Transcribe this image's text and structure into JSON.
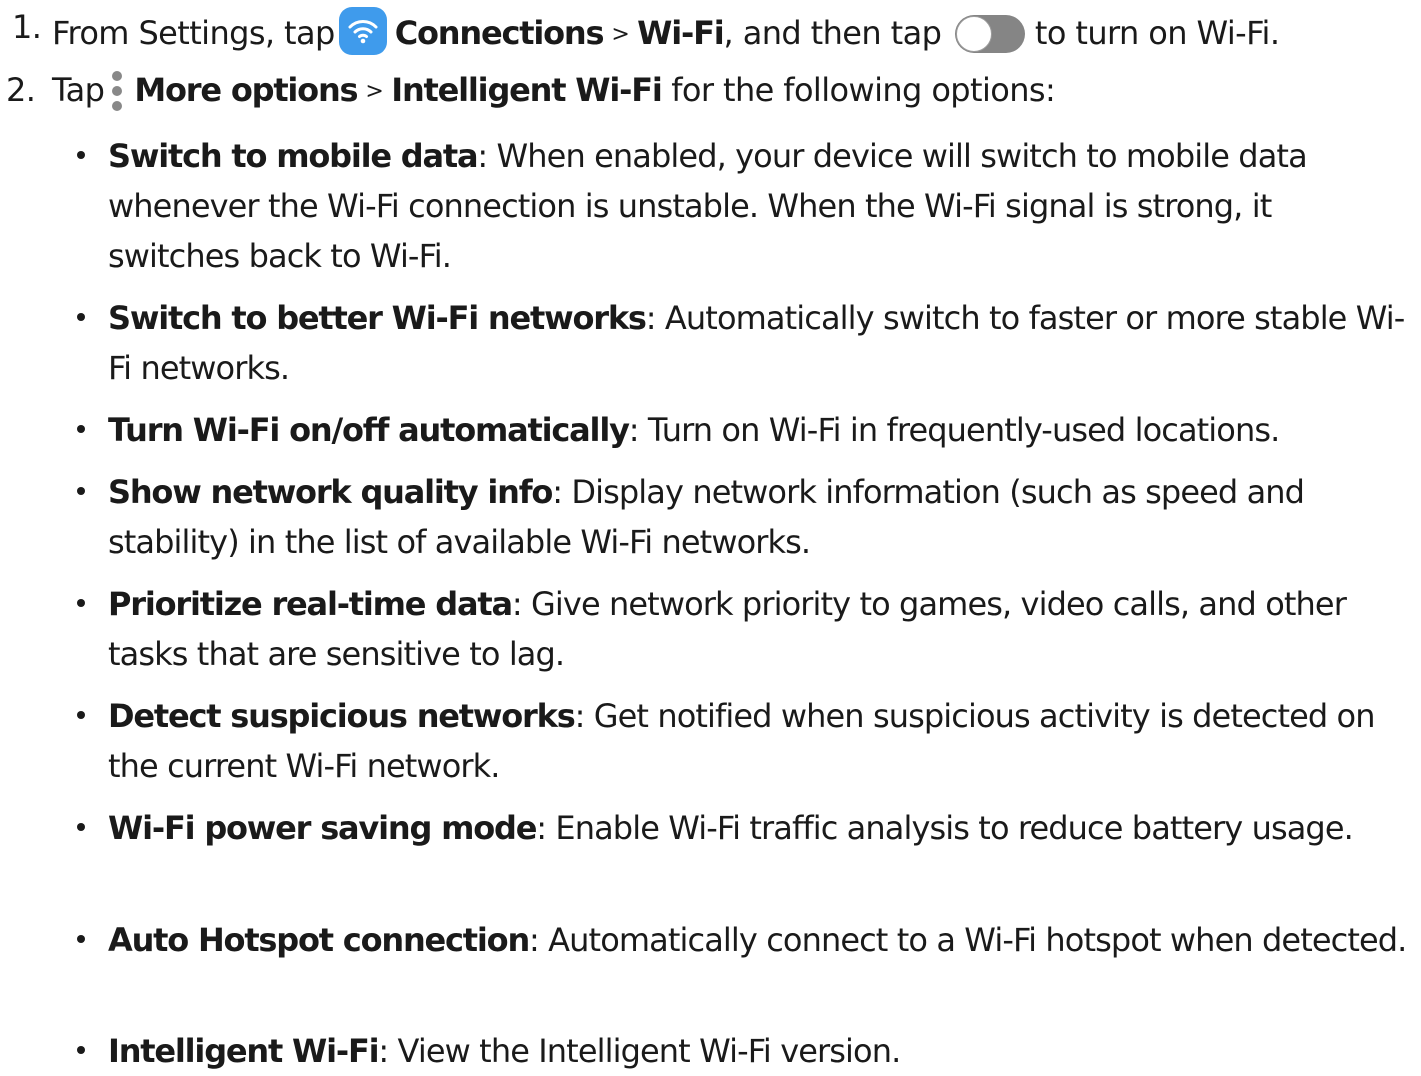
{
  "steps": [
    {
      "number": "1.",
      "text_1": "From Settings, tap",
      "icon_1": "wifi-icon",
      "bold_1": "Connections",
      "separator": ">",
      "bold_2": "Wi-Fi",
      "text_2": ", and then tap",
      "icon_2": "toggle-switch-icon",
      "text_3": "to turn on Wi-Fi."
    },
    {
      "number": "2.",
      "text_1": "Tap",
      "icon_1": "more-options-icon",
      "bold_1": "More options",
      "separator": ">",
      "bold_2": "Intelligent Wi-Fi",
      "text_2": " for the following options:"
    }
  ],
  "options": [
    {
      "title": "Switch to mobile data",
      "description": ": When enabled, your device will switch to mobile data whenever the Wi-Fi connection is unstable. When the Wi-Fi signal is strong, it switches back to Wi-Fi."
    },
    {
      "title": "Switch to better Wi-Fi networks",
      "description": ": Automatically switch to faster or more stable Wi-Fi networks."
    },
    {
      "title": "Turn Wi-Fi on/off automatically",
      "description": ": Turn on Wi-Fi in frequently-used locations."
    },
    {
      "title": "Show network quality info",
      "description": ": Display network information (such as speed and stability) in the list of available Wi-Fi networks."
    },
    {
      "title": "Prioritize real-time data",
      "description": ": Give network priority to games, video calls, and other tasks that are sensitive to lag."
    },
    {
      "title": "Detect suspicious networks",
      "description": ": Get notified when suspicious activity is detected on the current Wi-Fi network."
    },
    {
      "title": "Wi-Fi power saving mode",
      "description": ": Enable Wi-Fi traffic analysis to reduce battery usage."
    },
    {
      "title": "Auto Hotspot connection",
      "description": ": Automatically connect to a Wi-Fi hotspot when detected."
    },
    {
      "title": "Intelligent Wi-Fi",
      "description": ": View the Intelligent Wi-Fi version."
    }
  ],
  "colors": {
    "text": "#1a1a1a",
    "wifi_icon_bg": "#3f9bec",
    "toggle_track": "#858585",
    "more_options_dots": "#888888"
  }
}
